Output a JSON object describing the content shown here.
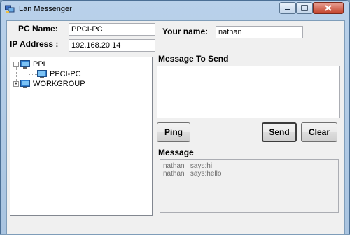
{
  "window": {
    "title": "Lan Messenger"
  },
  "labels": {
    "pc_name": "PC Name:",
    "ip_address": "IP Address :",
    "your_name": "Your name:",
    "message_to_send": "Message To Send",
    "message": "Message"
  },
  "fields": {
    "pc_name_value": "PPCI-PC",
    "ip_address_value": "192.168.20.14",
    "your_name_value": "nathan",
    "message_to_send_value": ""
  },
  "tree": {
    "items": [
      {
        "label": "PPL",
        "expander": "−"
      },
      {
        "label": "PPCI-PC"
      },
      {
        "label": "WORKGROUP",
        "expander": "+"
      }
    ]
  },
  "buttons": {
    "ping": "Ping",
    "send": "Send",
    "clear": "Clear"
  },
  "messages": [
    "nathan   says:hi",
    "nathan   says:hello"
  ],
  "colors": {
    "title_bar": "#b9d1ea",
    "client_bg": "#f0f0f0",
    "close_button": "#c4432b"
  }
}
